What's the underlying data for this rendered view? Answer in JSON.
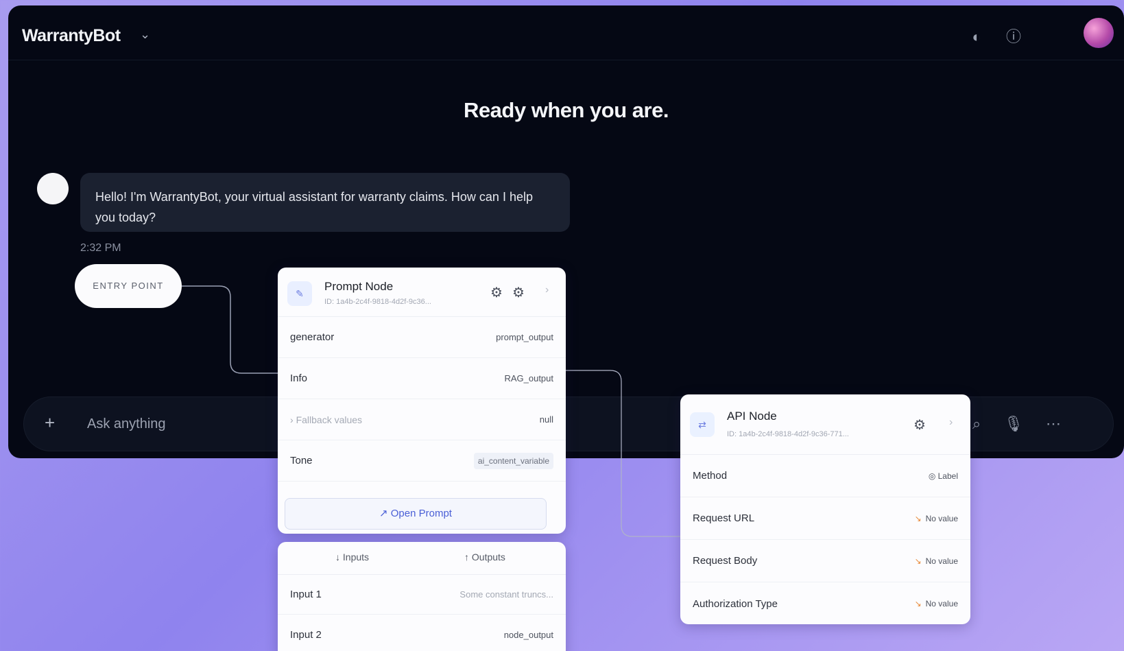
{
  "topbar": {
    "title": "WarrantyBot",
    "icons": [
      "theme-toggle-icon",
      "help-icon",
      "avatar"
    ]
  },
  "headline": "Ready when you are.",
  "chat": {
    "message": "Hello! I'm WarrantyBot, your virtual assistant for warranty claims. How can I help you today?",
    "time": "2:32 PM"
  },
  "composer": {
    "placeholder": "Ask anything"
  },
  "entry_point": {
    "label": "ENTRY POINT"
  },
  "prompt_node": {
    "title": "Prompt Node",
    "id": "ID: 1a4b-2c4f-9818-4d2f-9c36...",
    "rows": [
      {
        "label": "generator",
        "value": "prompt_output"
      },
      {
        "label": "Info",
        "value": "RAG_output"
      },
      {
        "label": "Fallback values",
        "value": "null"
      },
      {
        "label": "Tone",
        "value": "ai_content_variable"
      }
    ],
    "open_button": "Open Prompt"
  },
  "io_card": {
    "tabs": [
      "Inputs",
      "Outputs"
    ],
    "rows": [
      {
        "label": "Input 1",
        "value": "Some constant truncs..."
      },
      {
        "label": "Input 2",
        "value": "node_output"
      }
    ]
  },
  "api_node": {
    "title": "API Node",
    "id": "ID: 1a4b-2c4f-9818-4d2f-9c36-771...",
    "rows": [
      {
        "label": "Method",
        "value": "Label"
      },
      {
        "label": "Request URL",
        "value": "No value"
      },
      {
        "label": "Request Body",
        "value": "No value"
      },
      {
        "label": "Authorization Type",
        "value": "No value"
      }
    ]
  },
  "colors": {
    "window_bg": "#050814",
    "bubble_bg": "#1b2130",
    "accent": "#4a5fd6",
    "page_gradient_start": "#a99cf0",
    "warning": "#e88a3a"
  }
}
